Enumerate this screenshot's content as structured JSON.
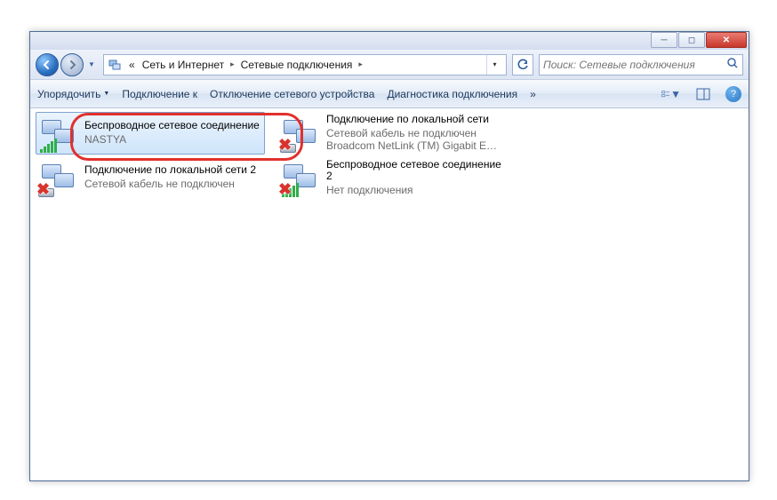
{
  "titlebar": {
    "min_tooltip": "Свернуть",
    "max_tooltip": "Развернуть",
    "close_tooltip": "Закрыть"
  },
  "breadcrumb": {
    "prefix": "«",
    "seg1": "Сеть и Интернет",
    "seg2": "Сетевые подключения"
  },
  "search": {
    "placeholder": "Поиск: Сетевые подключения"
  },
  "toolbar": {
    "organize": "Упорядочить",
    "connect_to": "Подключение к",
    "disable_device": "Отключение сетевого устройства",
    "diagnose": "Диагностика подключения"
  },
  "connections": [
    {
      "kind": "wifi",
      "selected": true,
      "disabled": false,
      "title": "Беспроводное сетевое соединение",
      "sub1": "NASTYA",
      "sub2": ""
    },
    {
      "kind": "lan",
      "selected": false,
      "disabled": true,
      "title": "Подключение по локальной сети",
      "sub1": "Сетевой кабель не подключен",
      "sub2": "Broadcom NetLink (TM) Gigabit E…"
    },
    {
      "kind": "lan",
      "selected": false,
      "disabled": true,
      "title": "Подключение по локальной сети 2",
      "sub1": "Сетевой кабель не подключен",
      "sub2": ""
    },
    {
      "kind": "wifi",
      "selected": false,
      "disabled": true,
      "title": "Беспроводное сетевое соединение 2",
      "sub1": "Нет подключения",
      "sub2": ""
    }
  ]
}
